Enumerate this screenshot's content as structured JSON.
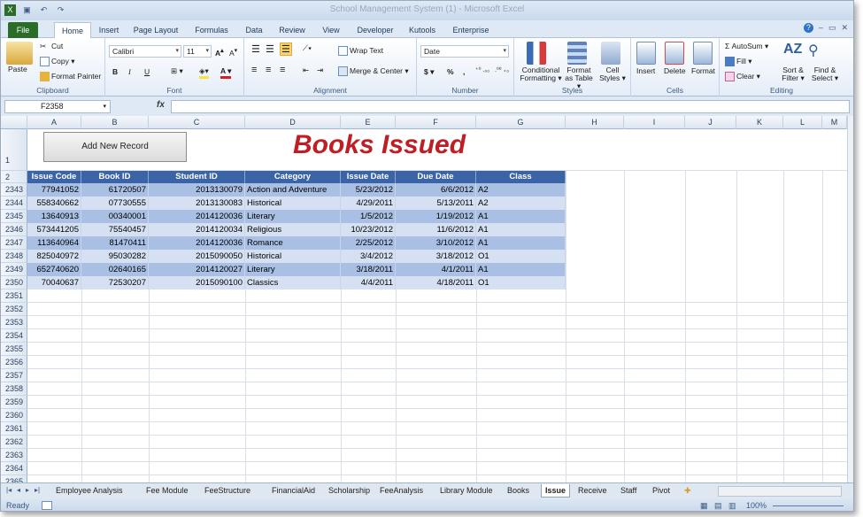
{
  "window": {
    "title": "School Management System (1) - Microsoft Excel"
  },
  "tabs": [
    "File",
    "Home",
    "Insert",
    "Page Layout",
    "Formulas",
    "Data",
    "Review",
    "View",
    "Developer",
    "Kutools",
    "Enterprise"
  ],
  "ribbon": {
    "clipboard": {
      "paste": "Paste",
      "cut": "Cut",
      "copy": "Copy ▾",
      "format_painter": "Format Painter",
      "label": "Clipboard"
    },
    "font": {
      "name": "Calibri",
      "size": "11",
      "bold": "B",
      "italic": "I",
      "underline": "U",
      "label": "Font"
    },
    "alignment": {
      "wrap": "Wrap Text",
      "merge": "Merge & Center ▾",
      "label": "Alignment"
    },
    "number": {
      "format": "Date",
      "currency": "$ ▾",
      "percent": "%",
      "comma": ",",
      "label": "Number"
    },
    "styles": {
      "conditional": "Conditional Formatting ▾",
      "format_table": "Format as Table ▾",
      "cell_styles": "Cell Styles ▾",
      "label": "Styles"
    },
    "cells": {
      "insert": "Insert",
      "delete": "Delete",
      "format": "Format",
      "label": "Cells"
    },
    "editing": {
      "autosum": "Σ AutoSum ▾",
      "fill": "Fill ▾",
      "clear": "Clear ▾",
      "sort": "Sort & Filter ▾",
      "find": "Find & Select ▾",
      "label": "Editing"
    }
  },
  "formula_bar": {
    "name_box": "F2358",
    "fx": "fx",
    "value": ""
  },
  "columns": [
    "A",
    "B",
    "C",
    "D",
    "E",
    "F",
    "G",
    "H",
    "I",
    "J",
    "K",
    "L",
    "M"
  ],
  "sheet": {
    "button": "Add New Record",
    "heading": "Books Issued",
    "headers": [
      "Issue Code",
      "Book ID",
      "Student ID",
      "Category",
      "Issue Date",
      "Due Date",
      "Class"
    ],
    "first_rows": [
      "1",
      "2"
    ],
    "rows": [
      {
        "n": "2343",
        "cells": [
          "77941052",
          "61720507",
          "2013130079",
          "Action and Adventure",
          "5/23/2012",
          "6/6/2012",
          "A2"
        ]
      },
      {
        "n": "2344",
        "cells": [
          "558340662",
          "07730555",
          "2013130083",
          "Historical",
          "4/29/2011",
          "5/13/2011",
          "A2"
        ]
      },
      {
        "n": "2345",
        "cells": [
          "13640913",
          "00340001",
          "2014120036",
          "Literary",
          "1/5/2012",
          "1/19/2012",
          "A1"
        ]
      },
      {
        "n": "2346",
        "cells": [
          "573441205",
          "75540457",
          "2014120034",
          "Religious",
          "10/23/2012",
          "11/6/2012",
          "A1"
        ]
      },
      {
        "n": "2347",
        "cells": [
          "113640964",
          "81470411",
          "2014120036",
          "Romance",
          "2/25/2012",
          "3/10/2012",
          "A1"
        ]
      },
      {
        "n": "2348",
        "cells": [
          "825040972",
          "95030282",
          "2015090050",
          "Historical",
          "3/4/2012",
          "3/18/2012",
          "O1"
        ]
      },
      {
        "n": "2349",
        "cells": [
          "652740620",
          "02640165",
          "2014120027",
          "Literary",
          "3/18/2011",
          "4/1/2011",
          "A1"
        ]
      },
      {
        "n": "2350",
        "cells": [
          "70040637",
          "72530207",
          "2015090100",
          "Classics",
          "4/4/2011",
          "4/18/2011",
          "O1"
        ]
      }
    ],
    "empty_rows": [
      "2351",
      "2352",
      "2353",
      "2354",
      "2355",
      "2356",
      "2357",
      "2358",
      "2359",
      "2360",
      "2361",
      "2362",
      "2363",
      "2364",
      "2365"
    ]
  },
  "sheet_tabs": [
    "Employee Analysis",
    "Fee Module",
    "FeeStructure",
    "FinancialAid",
    "Scholarship",
    "FeeAnalysis",
    "Library Module",
    "Books",
    "Issue",
    "Receive",
    "Staff",
    "Pivot"
  ],
  "active_sheet": "Issue",
  "status": {
    "mode": "Ready",
    "zoom": "100%"
  },
  "colors": {
    "header_bg": "#3a64a6",
    "band_a": "#a9c0e4",
    "band_b": "#d5e1f3",
    "heading": "#bf1e24",
    "file_tab": "#2a6d28"
  }
}
